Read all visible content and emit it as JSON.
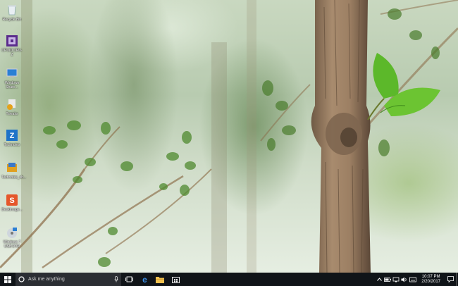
{
  "desktop": {
    "icons": [
      {
        "name": "recycle-bin-icon",
        "label": "Recycle Bin"
      },
      {
        "name": "cpuid-icon",
        "label": "CPUID CPU-Z"
      },
      {
        "name": "windows-share-icon",
        "label": "Windows\nShare..."
      },
      {
        "name": "tweaks-icon",
        "label": "Tweaks"
      },
      {
        "name": "technotes-icon",
        "label": "Technotes"
      },
      {
        "name": "technotes-shortcut-icon",
        "label": "Technotes_sh..."
      },
      {
        "name": "deskimage-icon",
        "label": "DeskImage..."
      },
      {
        "name": "windows7-usb-dvd-icon",
        "label": "Windows 7\nUSB DVD"
      }
    ]
  },
  "taskbar": {
    "search_placeholder": "Ask me anything",
    "pinned": [
      "start-button",
      "task-view-button",
      "edge-button",
      "file-explorer-button",
      "store-button"
    ],
    "clock_time": "10:07 PM",
    "clock_date": "2/20/2017",
    "colors": {
      "bar": "#101418",
      "search": "#2b2e33",
      "edge": "#3b8fe6",
      "folder": "#f2c14e"
    }
  }
}
